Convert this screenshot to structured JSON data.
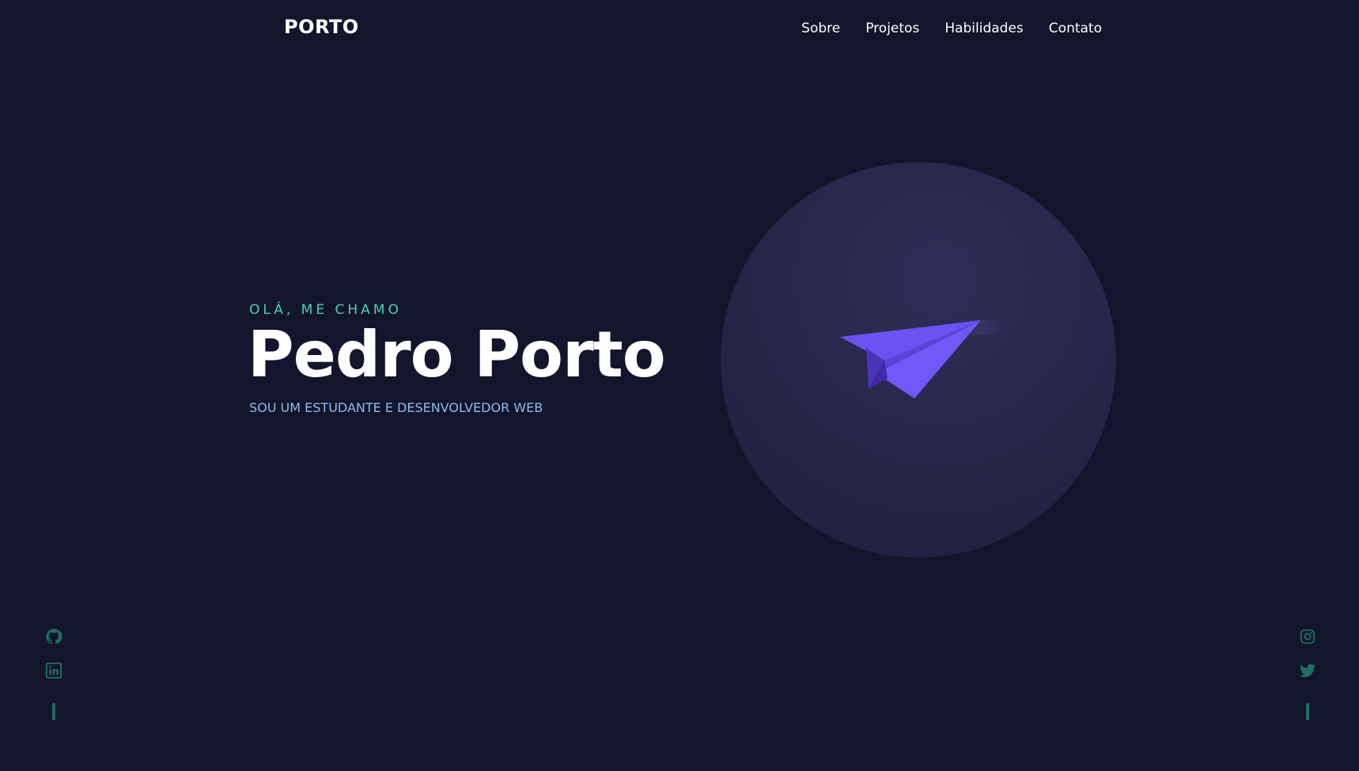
{
  "header": {
    "logo": "PORTO",
    "nav": [
      "Sobre",
      "Projetos",
      "Habilidades",
      "Contato"
    ]
  },
  "hero": {
    "greeting": "OLÁ, ME CHAMO",
    "name": "Pedro Porto",
    "subtitle": "SOU UM ESTUDANTE E DESENVOLVEDOR WEB",
    "illustration": "paper-plane-icon"
  },
  "social": {
    "left": [
      "github-icon",
      "linkedin-icon"
    ],
    "right": [
      "instagram-icon",
      "twitter-icon"
    ]
  },
  "colors": {
    "background": "#12152b",
    "accent_green": "#45d5b0",
    "accent_blue": "#8fbcea",
    "plane_purple": "#6a52f3",
    "social_teal": "#1f6e6a"
  }
}
